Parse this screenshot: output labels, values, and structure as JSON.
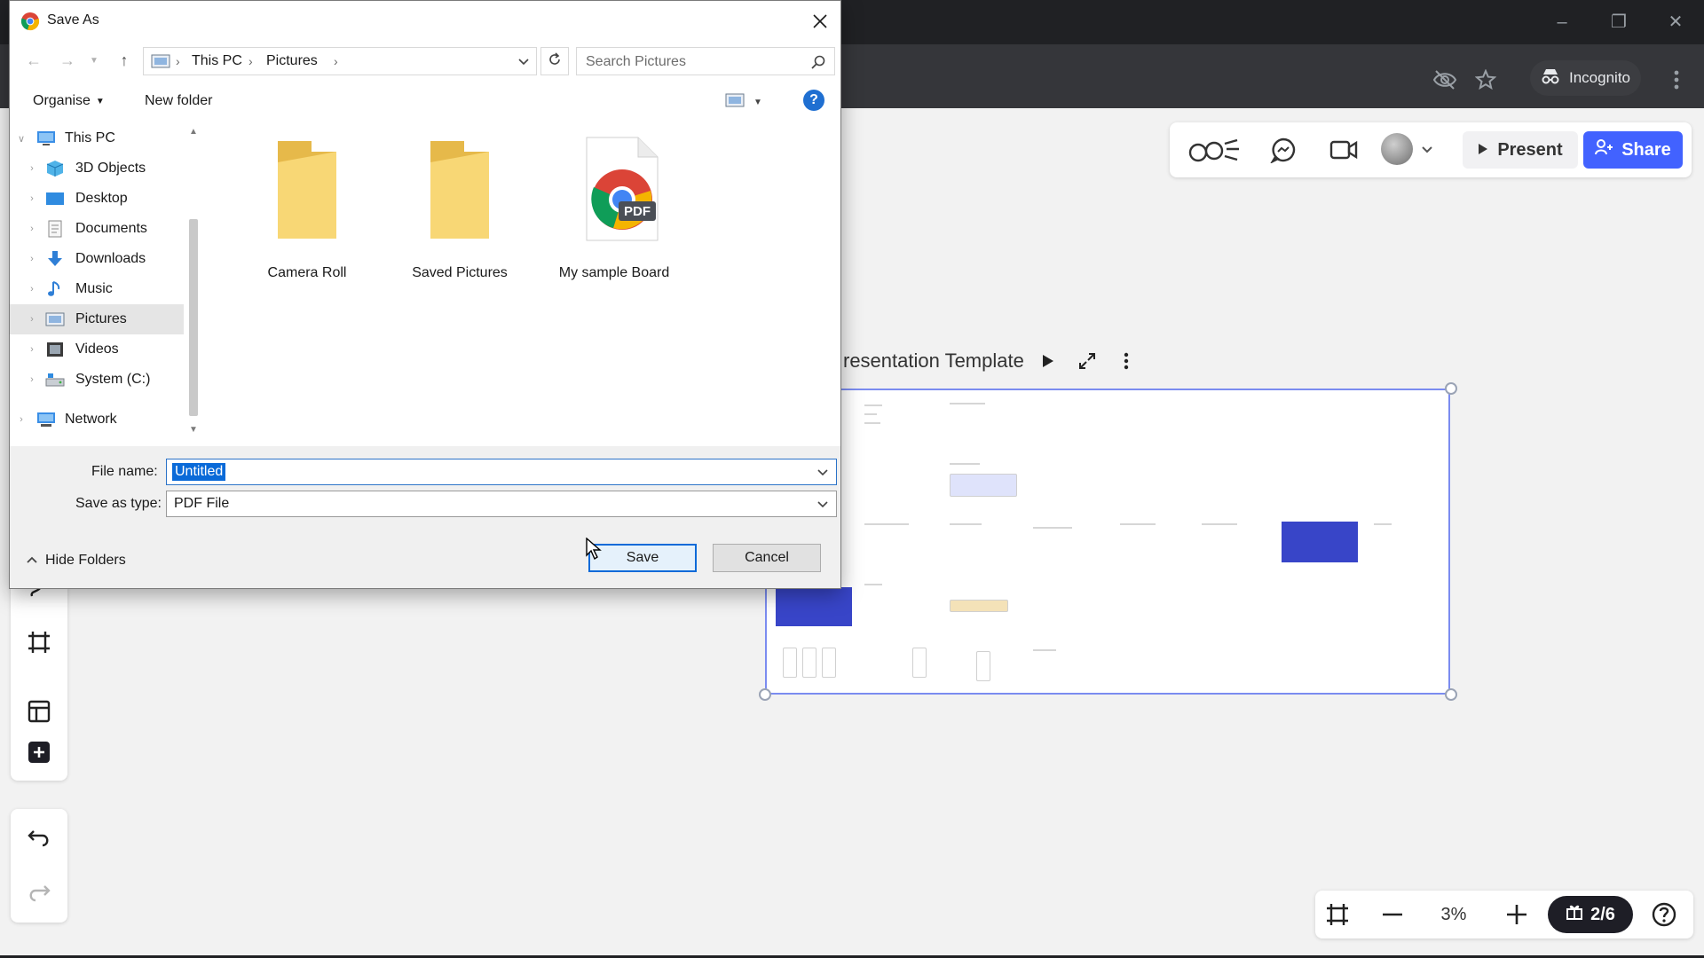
{
  "browser": {
    "incognito_label": "Incognito"
  },
  "board": {
    "toolbar": {
      "present_label": "Present",
      "share_label": "Share"
    },
    "frame_title": "resentation Template",
    "zoom": {
      "level": "3%",
      "page_indicator": "2/6"
    }
  },
  "dialog": {
    "title": "Save As",
    "address": {
      "crumbs": [
        "This PC",
        "Pictures"
      ]
    },
    "search": {
      "placeholder": "Search Pictures"
    },
    "commands": {
      "organise": "Organise",
      "new_folder": "New folder"
    },
    "nav_tree": [
      {
        "label": "This PC",
        "icon": "computer-icon"
      },
      {
        "label": "3D Objects",
        "icon": "3d-objects-icon"
      },
      {
        "label": "Desktop",
        "icon": "desktop-icon"
      },
      {
        "label": "Documents",
        "icon": "documents-icon"
      },
      {
        "label": "Downloads",
        "icon": "downloads-icon"
      },
      {
        "label": "Music",
        "icon": "music-icon"
      },
      {
        "label": "Pictures",
        "icon": "pictures-icon",
        "selected": true
      },
      {
        "label": "Videos",
        "icon": "videos-icon"
      },
      {
        "label": "System (C:)",
        "icon": "drive-icon"
      },
      {
        "label": "Network",
        "icon": "network-icon"
      }
    ],
    "files": [
      {
        "name": "Camera Roll",
        "type": "folder"
      },
      {
        "name": "Saved Pictures",
        "type": "folder"
      },
      {
        "name": "My sample Board",
        "type": "pdf",
        "badge": "PDF"
      }
    ],
    "form": {
      "filename_label": "File name:",
      "filename_value": "Untitled",
      "type_label": "Save as type:",
      "type_value": "PDF File"
    },
    "buttons": {
      "hide_folders": "Hide Folders",
      "save": "Save",
      "cancel": "Cancel"
    }
  },
  "colors": {
    "accent_blue": "#4262ff",
    "selection_blue": "#0a6ad8",
    "chrome_dark": "#202124"
  }
}
